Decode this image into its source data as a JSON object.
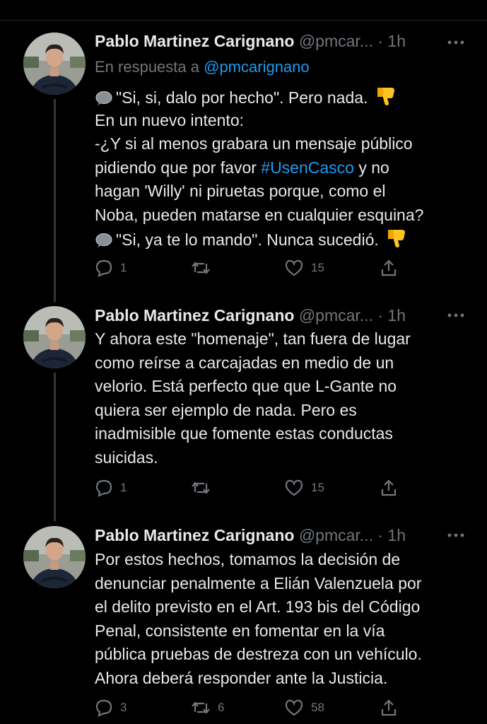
{
  "tweets": [
    {
      "name": "Pablo Martinez Carignano",
      "handle": "@pmcar...",
      "time": "· 1h",
      "reply_prefix": "En respuesta a",
      "reply_to": "@pmcarignano",
      "lines": {
        "l1": "\"Si, si, dalo por hecho\". Pero nada.",
        "l2": "En un nuevo intento:",
        "l3": "-¿Y si al menos grabara un mensaje público",
        "l4a": "pidiendo que por favor ",
        "l4_hashtag": "#UsenCasco",
        "l4b": " y no",
        "l5": "hagan 'Willy' ni piruetas porque, como el",
        "l6": "Noba, pueden matarse en cualquier esquina?",
        "l7": "\"Si, ya te lo mando\". Nunca sucedió."
      },
      "replies": "1",
      "retweets": "",
      "likes": "15"
    },
    {
      "name": "Pablo Martinez Carignano",
      "handle": "@pmcar...",
      "time": "· 1h",
      "lines": [
        "Y ahora este \"homenaje\", tan fuera de lugar",
        "como reírse a carcajadas en medio de un",
        "velorio. Está perfecto que que L-Gante no",
        "quiera ser ejemplo de nada. Pero es",
        "inadmisible que fomente estas conductas",
        "suicidas."
      ],
      "replies": "1",
      "retweets": "",
      "likes": "15"
    },
    {
      "name": "Pablo Martinez Carignano",
      "handle": "@pmcar...",
      "time": "· 1h",
      "lines": [
        "Por estos hechos, tomamos la decisión de",
        "denunciar penalmente a Elián Valenzuela por",
        "el delito previsto en el Art. 193 bis del Código",
        "Penal, consistente en fomentar en la vía",
        "pública pruebas de destreza con un vehículo.",
        "Ahora deberá responder ante la Justicia."
      ],
      "replies": "3",
      "retweets": "6",
      "likes": "58"
    }
  ],
  "colors": {
    "background": "#000000",
    "text": "#e7e9ea",
    "muted": "#71767b",
    "link": "#1d9bf0",
    "thread_line": "#333639"
  },
  "icons": [
    "reply-icon",
    "retweet-icon",
    "like-icon",
    "share-icon",
    "more-icon",
    "speech-bubble-icon",
    "thumbs-down-icon"
  ]
}
